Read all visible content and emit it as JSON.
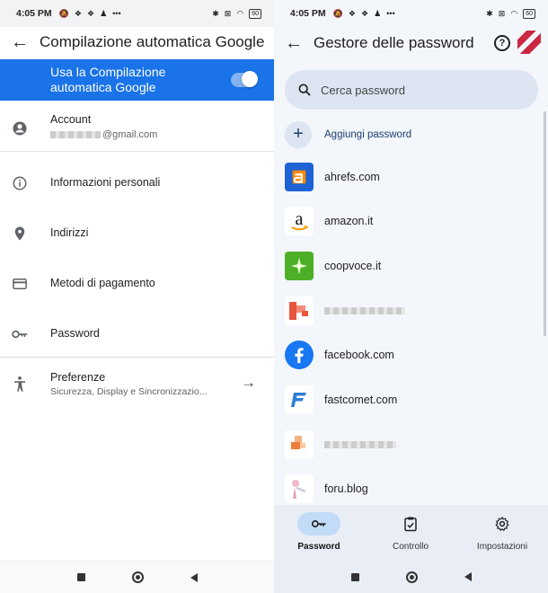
{
  "left": {
    "status_time": "4:05 PM",
    "battery": "60",
    "title": "Compilazione automatica Google",
    "toggle_label": "Usa la Compilazione automatica Google",
    "account_label": "Account",
    "account_email_suffix": "@gmail.com",
    "items": [
      {
        "label": "Informazioni personali",
        "icon": "info-icon"
      },
      {
        "label": "Indirizzi",
        "icon": "location-pin-icon"
      },
      {
        "label": "Metodi di pagamento",
        "icon": "credit-card-icon"
      },
      {
        "label": "Password",
        "icon": "key-icon"
      }
    ],
    "prefs_label": "Preferenze",
    "prefs_sub": "Sicurezza, Display e Sincronizzazio..."
  },
  "right": {
    "status_time": "4:05 PM",
    "battery": "60",
    "title": "Gestore delle password",
    "search_placeholder": "Cerca password",
    "add_label": "Aggiungi password",
    "sites": [
      {
        "name": "ahrefs.com"
      },
      {
        "name": "amazon.it"
      },
      {
        "name": "coopvoce.it"
      },
      {
        "name": ""
      },
      {
        "name": "facebook.com"
      },
      {
        "name": "fastcomet.com"
      },
      {
        "name": ""
      },
      {
        "name": "foru.blog"
      }
    ],
    "tabs": [
      {
        "label": "Password"
      },
      {
        "label": "Controllo"
      },
      {
        "label": "Impostazioni"
      }
    ]
  },
  "colors": {
    "accent": "#1a73e8",
    "bar": "#e9eef6",
    "search_bg": "#dde5f2"
  }
}
